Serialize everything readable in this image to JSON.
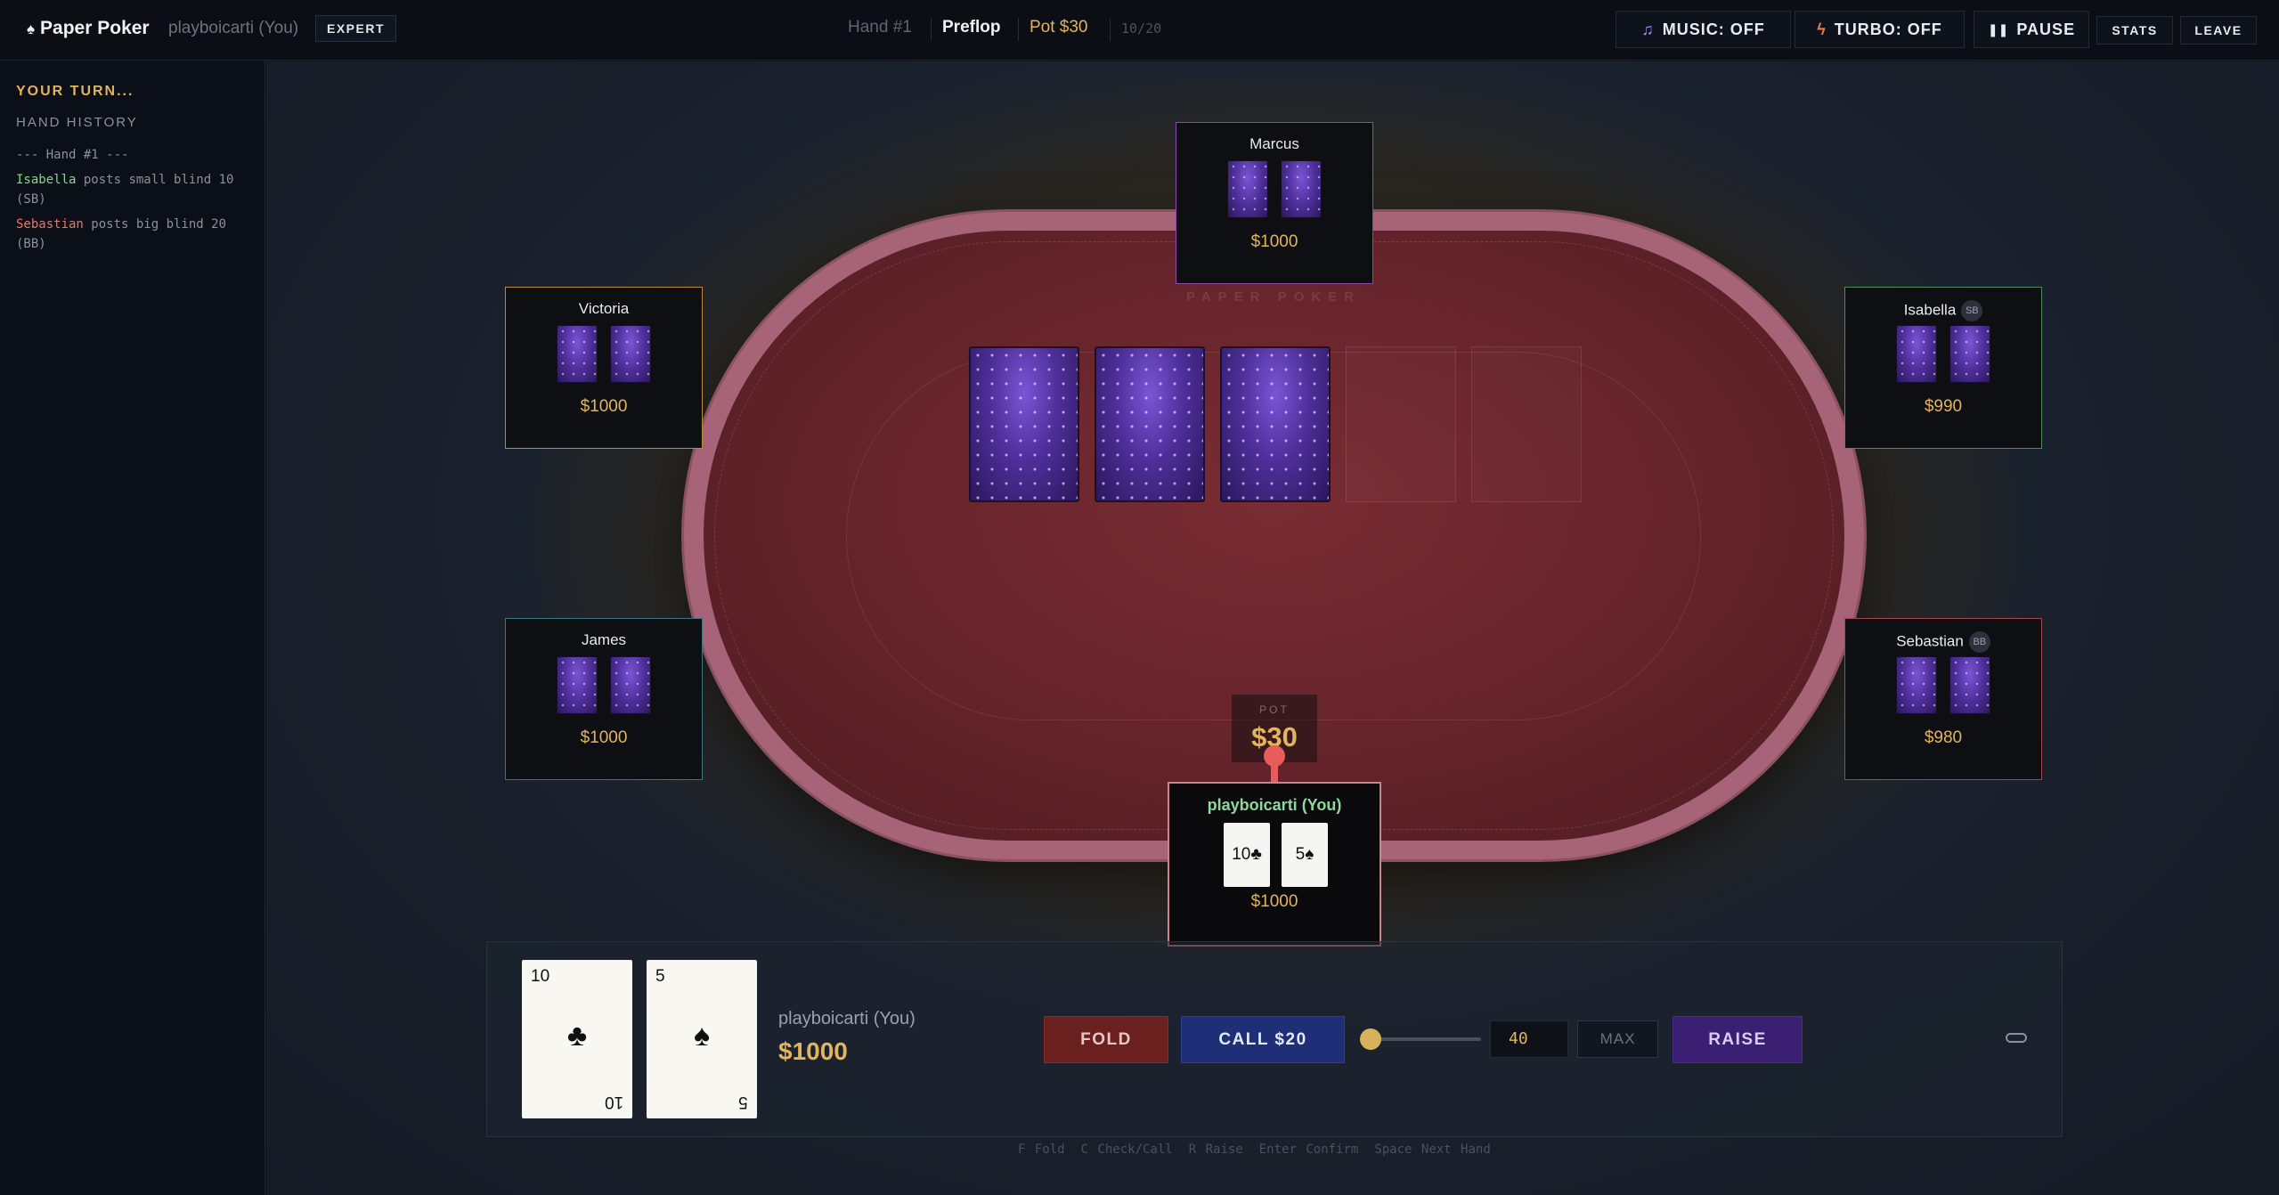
{
  "header": {
    "brand": "Paper Poker",
    "player": "playboicarti (You)",
    "difficulty": "EXPERT",
    "hand_label": "Hand #1",
    "phase": "Preflop",
    "pot_label": "Pot $30",
    "blinds": "10/20",
    "music": "MUSIC: OFF",
    "turbo": "TURBO: OFF",
    "pause": "PAUSE",
    "stats": "STATS",
    "leave": "LEAVE"
  },
  "sidebar": {
    "status": "YOUR TURN...",
    "history_title": "HAND HISTORY",
    "log": [
      {
        "text": "--- Hand #1 ---"
      },
      {
        "name": "Isabella",
        "text": " posts small blind 10 (SB)"
      },
      {
        "name": "Sebastian",
        "text": " posts big blind 20 (BB)"
      }
    ]
  },
  "table": {
    "felt_text": "PAPER POKER",
    "pot_label": "POT",
    "pot_amount": "$30",
    "community_cards": [
      "face-down",
      "face-down",
      "face-down",
      "empty",
      "empty"
    ]
  },
  "seats": {
    "marcus": {
      "name": "Marcus",
      "stack": "$1000",
      "color": "#8b4aa8"
    },
    "victoria": {
      "name": "Victoria",
      "stack": "$1000",
      "color": "#b88a3e"
    },
    "isabella": {
      "name": "Isabella",
      "badge": "SB",
      "stack": "$990",
      "color": "#4f8a58"
    },
    "james": {
      "name": "James",
      "stack": "$1000",
      "color": "#3c7480"
    },
    "sebastian": {
      "name": "Sebastian",
      "badge": "BB",
      "stack": "$980",
      "color": "#a3474c"
    },
    "hero": {
      "name": "playboicarti (You)",
      "stack": "$1000",
      "card1": "10♣",
      "card2": "5♠"
    }
  },
  "action_panel": {
    "card1": {
      "rank": "10",
      "suit": "♣"
    },
    "card2": {
      "rank": "5",
      "suit": "♠"
    },
    "player": "playboicarti (You)",
    "stack": "$1000",
    "fold": "FOLD",
    "call": "CALL $20",
    "raise_value": "40",
    "max": "MAX",
    "raise": "RAISE",
    "raise_slider_fraction": 0.0
  },
  "shortcuts": [
    "F Fold",
    "C Check/Call",
    "R Raise",
    "Enter Confirm",
    "Space Next Hand"
  ],
  "colors": {
    "accent_gold": "#e2b45c",
    "felt": "#66242b",
    "rail": "#a76377"
  }
}
